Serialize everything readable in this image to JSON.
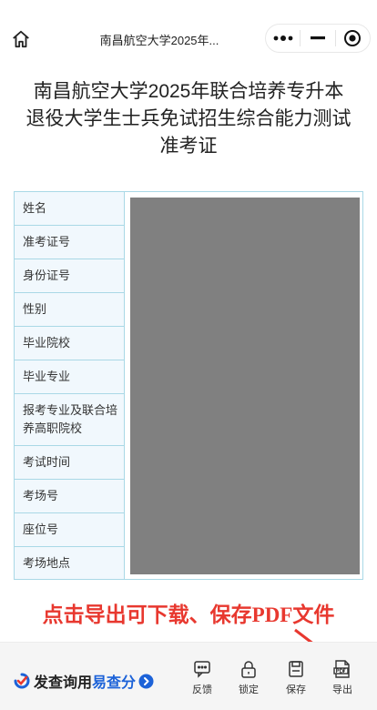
{
  "nav": {
    "title": "南昌航空大学2025年...",
    "icons": {
      "home": "home-icon",
      "more": "more-dots-icon",
      "minimize": "minus-icon",
      "close": "target-close-icon"
    }
  },
  "heading": {
    "line1": "南昌航空大学2025年联合培养专升本",
    "line2": "退役大学生士兵免试招生综合能力测试",
    "line3": "准考证"
  },
  "ticket": {
    "fields": [
      {
        "label": "姓名"
      },
      {
        "label": "准考证号"
      },
      {
        "label": "身份证号"
      },
      {
        "label": "性别"
      },
      {
        "label": "毕业院校"
      },
      {
        "label": "毕业专业"
      },
      {
        "label": "报考专业及联合培养高职院校"
      },
      {
        "label": "考试时间"
      },
      {
        "label": "考场号"
      },
      {
        "label": "座位号"
      },
      {
        "label": "考场地点"
      }
    ],
    "values_hidden": true
  },
  "notice": {
    "text": "点击导出可下载、保存PDF文件",
    "color": "#e8382f"
  },
  "footer": {
    "brand_prefix": "发查询用",
    "brand_name": "易查分",
    "brand_color": "#1c62d8",
    "tools": [
      {
        "label": "反馈",
        "icon": "feedback-icon"
      },
      {
        "label": "锁定",
        "icon": "lock-icon"
      },
      {
        "label": "保存",
        "icon": "save-icon"
      },
      {
        "label": "导出",
        "icon": "pdf-export-icon"
      }
    ]
  }
}
